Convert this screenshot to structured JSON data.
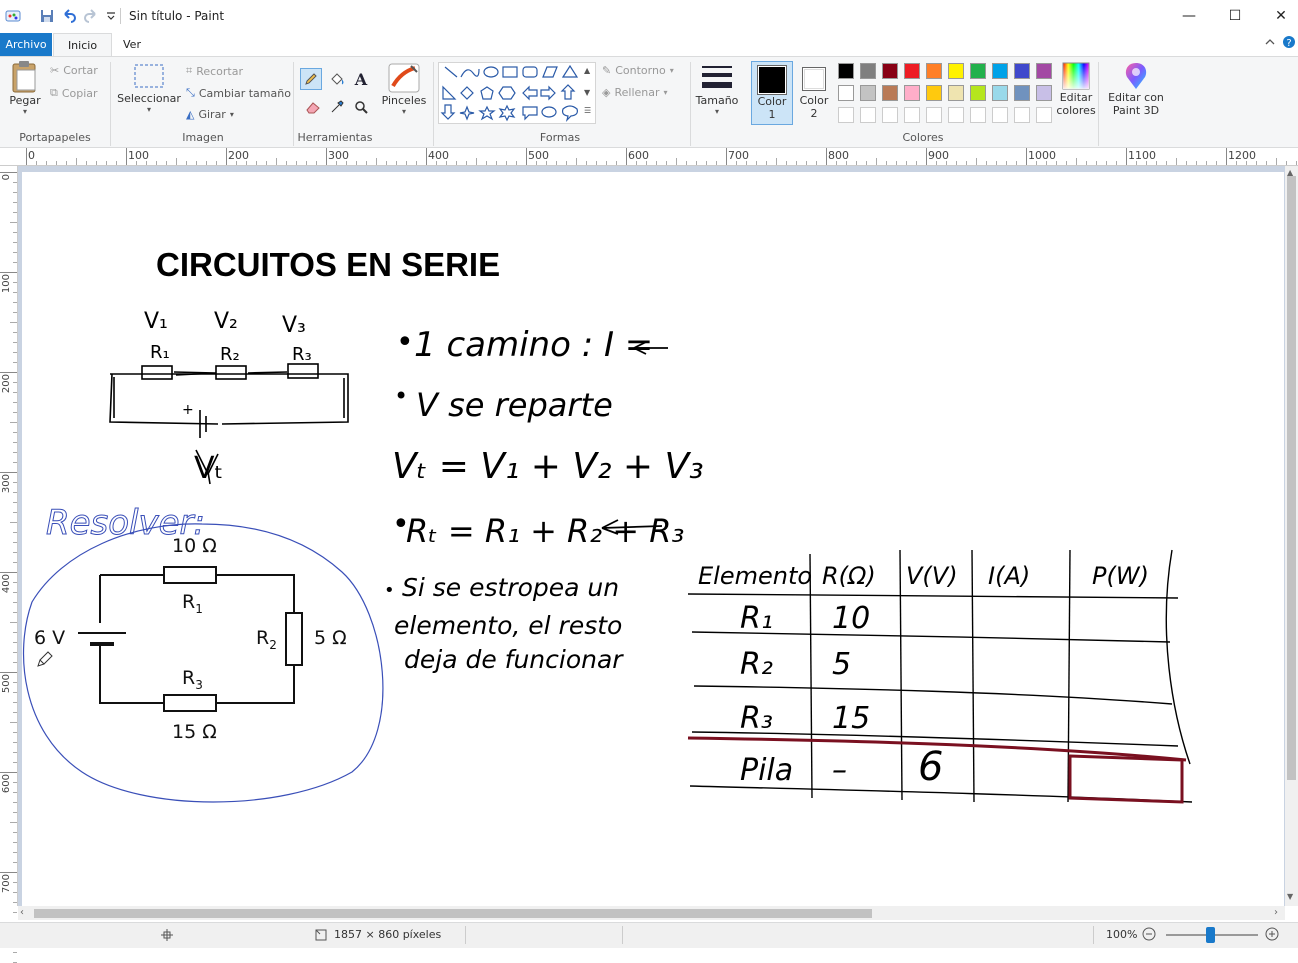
{
  "window": {
    "title": "Sin título - Paint",
    "minimize": "—",
    "maximize": "☐",
    "close": "✕"
  },
  "tabs": {
    "file": "Archivo",
    "home": "Inicio",
    "view": "Ver"
  },
  "ribbon": {
    "clipboard": {
      "paste": "Pegar",
      "cut": "Cortar",
      "copy": "Copiar",
      "group": "Portapapeles"
    },
    "image": {
      "select": "Seleccionar",
      "crop": "Recortar",
      "resize": "Cambiar tamaño",
      "rotate": "Girar",
      "group": "Imagen"
    },
    "tools": {
      "group": "Herramientas"
    },
    "brushes": {
      "label": "Pinceles"
    },
    "shapes": {
      "outline": "Contorno",
      "fill": "Rellenar",
      "group": "Formas"
    },
    "size": {
      "label": "Tamaño"
    },
    "colors": {
      "color1_label": "Color",
      "color1_num": "1",
      "color2_label": "Color",
      "color2_num": "2",
      "edit_colors_1": "Editar",
      "edit_colors_2": "colores",
      "paint3d_1": "Editar con",
      "paint3d_2": "Paint 3D",
      "group": "Colores",
      "color1": "#000000",
      "color2": "#ffffff",
      "palette_row1": [
        "#000000",
        "#7f7f7f",
        "#880015",
        "#ed1c24",
        "#ff7f27",
        "#fff200",
        "#22b14c",
        "#00a2e8",
        "#3f48cc",
        "#a349a4"
      ],
      "palette_row2": [
        "#ffffff",
        "#c3c3c3",
        "#b97a57",
        "#ffaec9",
        "#ffc90e",
        "#efe4b0",
        "#b5e61d",
        "#99d9ea",
        "#7092be",
        "#c8bfe7"
      ],
      "palette_row3": [
        "#ffffff",
        "#ffffff",
        "#ffffff",
        "#ffffff",
        "#ffffff",
        "#ffffff",
        "#ffffff",
        "#ffffff",
        "#ffffff",
        "#ffffff"
      ]
    }
  },
  "ruler": {
    "h_labels": [
      "0",
      "100",
      "200",
      "300",
      "400",
      "500",
      "600",
      "700",
      "800",
      "900",
      "1000",
      "1100",
      "1200"
    ],
    "v_labels": [
      "0",
      "100",
      "200",
      "300",
      "400",
      "500",
      "600",
      "700"
    ]
  },
  "drawing": {
    "title": "CIRCUITOS EN SERIE",
    "sketch_labels": {
      "v1": "V₁",
      "v2": "V₂",
      "v3": "V₃",
      "r1": "R₁",
      "r2": "R₂",
      "r3": "R₃",
      "vt": "Vₜ",
      "plus": "+"
    },
    "notes": {
      "n1": "1 camino : I =",
      "n2": "V se reparte",
      "n3": "Vₜ = V₁ + V₂ + V₃",
      "n4": "Rₜ = R₁ + R₂ + R₃",
      "n5a": "Si se estropea un",
      "n5b": "elemento, el resto",
      "n5c": "deja de funcionar",
      "bullet": "•"
    },
    "resolver": "Resolver:",
    "circuit": {
      "r1_value": "10 Ω",
      "r1_label": "R",
      "r1_sub": "1",
      "r2_label": "R",
      "r2_sub": "2",
      "r2_value": "5 Ω",
      "r3_label": "R",
      "r3_sub": "3",
      "r3_value": "15 Ω",
      "battery": "6 V"
    },
    "table": {
      "headers": [
        "Elemento",
        "R(Ω)",
        "V(V)",
        "I(A)",
        "P(W)"
      ],
      "rows": [
        [
          "R₁",
          "10",
          "",
          "",
          ""
        ],
        [
          "R₂",
          "5",
          "",
          "",
          ""
        ],
        [
          "R₃",
          "15",
          "",
          "",
          ""
        ],
        [
          "Pila",
          "–",
          "6",
          "",
          ""
        ]
      ]
    }
  },
  "status": {
    "dimensions": "1857 × 860 píxeles",
    "zoom": "100%"
  }
}
